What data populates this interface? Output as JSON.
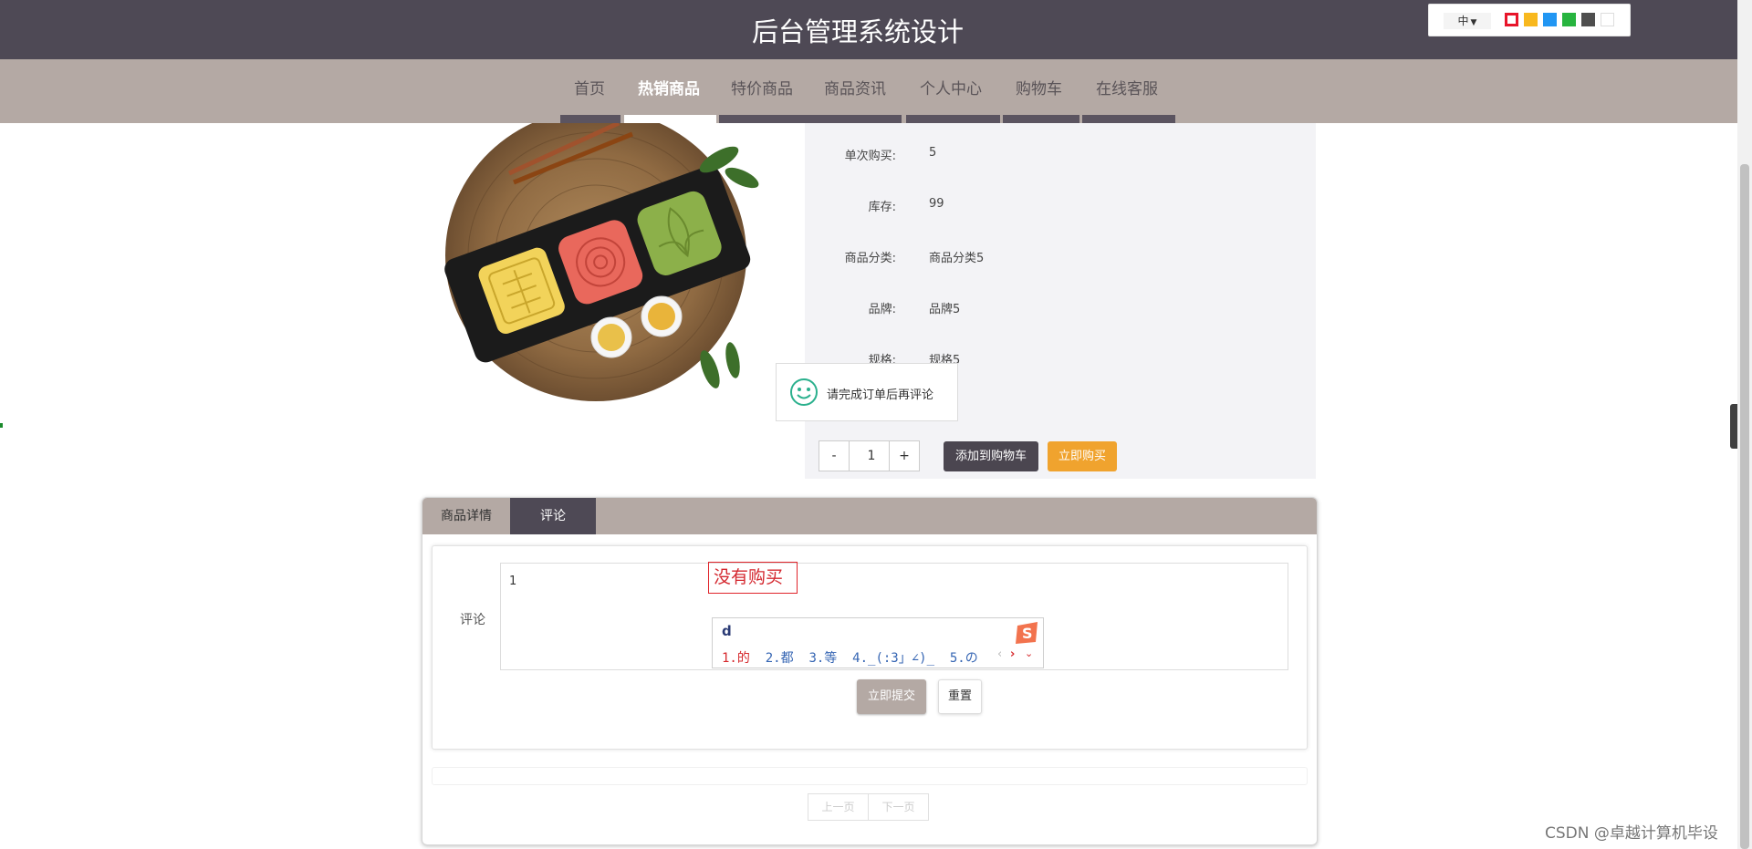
{
  "header": {
    "site_title": "后台管理系统设计",
    "language_selector": "中",
    "theme_colors": [
      "#e8152a",
      "#f8b81e",
      "#2196f3",
      "#27b43f",
      "#4e4e4e",
      "#ffffff"
    ]
  },
  "nav": {
    "items": [
      {
        "label": "首页"
      },
      {
        "label": "热销商品",
        "active": true
      },
      {
        "label": "特价商品"
      },
      {
        "label": "商品资讯"
      },
      {
        "label": "个人中心"
      },
      {
        "label": "购物车"
      },
      {
        "label": "在线客服"
      }
    ]
  },
  "product": {
    "image_alt": "mooncakes on black tray",
    "fields": [
      {
        "label": "单次购买:",
        "value": "5"
      },
      {
        "label": "库存:",
        "value": "99"
      },
      {
        "label": "商品分类:",
        "value": "商品分类5"
      },
      {
        "label": "品牌:",
        "value": "品牌5"
      },
      {
        "label": "规格:",
        "value": "规格5"
      }
    ],
    "quantity": {
      "minus": "-",
      "value": "1",
      "plus": "+"
    },
    "add_to_cart_label": "添加到购物车",
    "buy_now_label": "立即购买"
  },
  "toast": {
    "message": "请完成订单后再评论",
    "icon": "smile-icon"
  },
  "tabs": [
    {
      "label": "商品详情"
    },
    {
      "label": "评论",
      "active": true
    }
  ],
  "comment_form": {
    "label": "评论",
    "value": "1",
    "submit_label": "立即提交",
    "reset_label": "重置"
  },
  "pagination": {
    "prev_label": "上一页",
    "next_label": "下一页"
  },
  "annotation": {
    "text": "没有购买"
  },
  "ime": {
    "input": "d",
    "candidates": [
      "1.的",
      "2.都",
      "3.等",
      "4._(:3」∠)_",
      "5.の"
    ]
  },
  "watermark": "CSDN @卓越计算机毕设"
}
